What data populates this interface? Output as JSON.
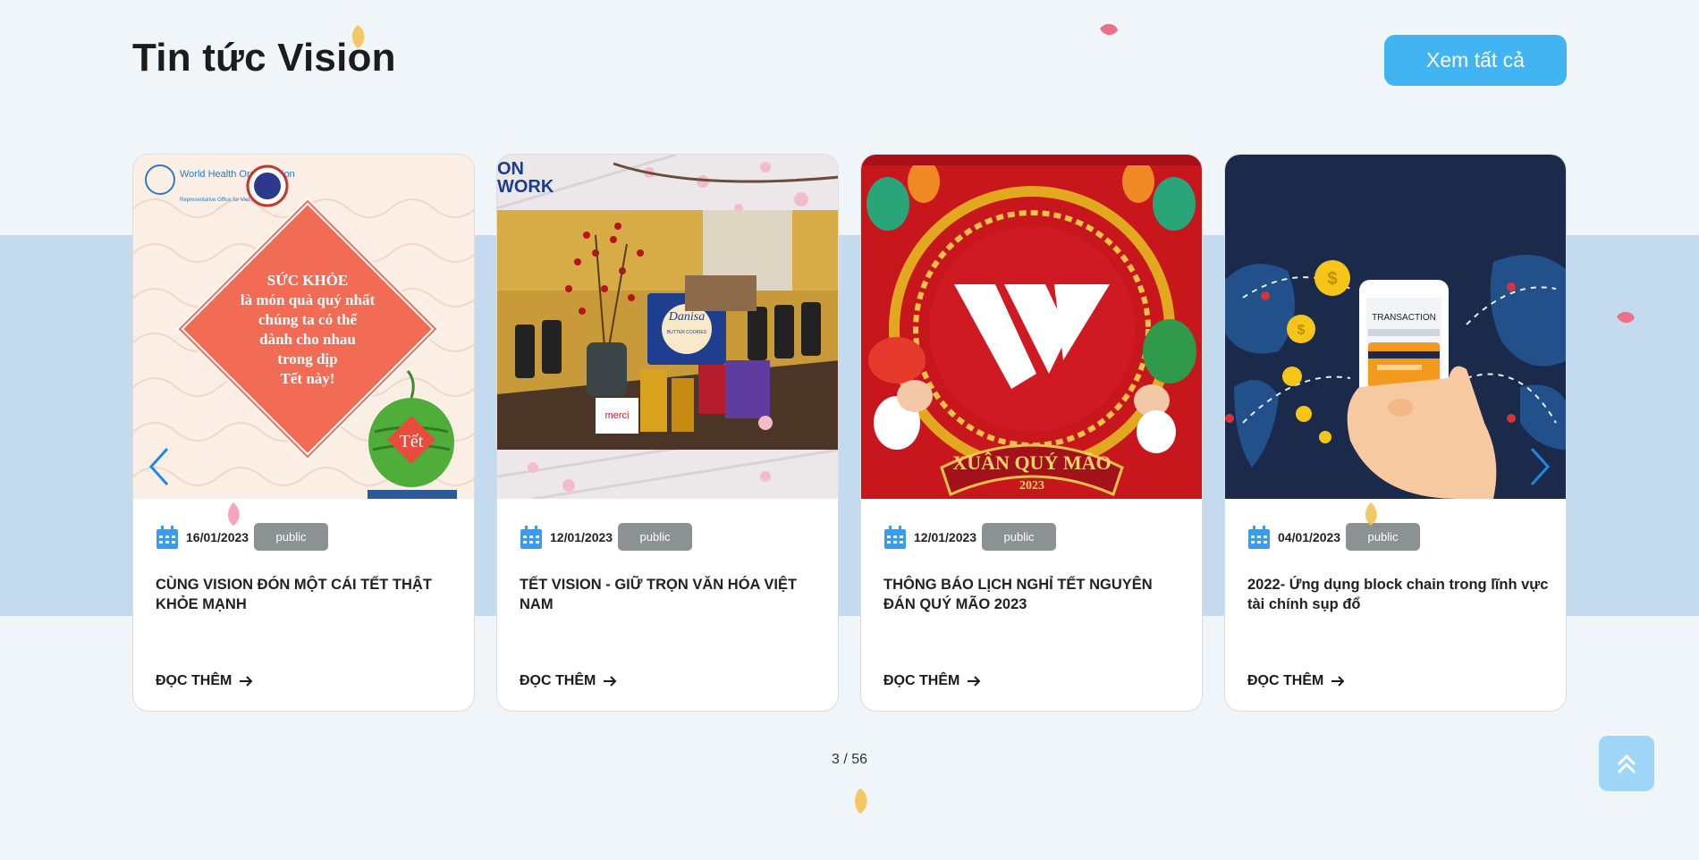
{
  "header": {
    "title": "Tin tức Vision",
    "view_all_label": "Xem tất cả"
  },
  "cards": [
    {
      "date": "16/01/2023",
      "badge": "public",
      "title": "CÙNG VISION ĐÓN MỘT CÁI TẾT THẬT KHỎE MẠNH",
      "read_more": "ĐỌC THÊM",
      "image": {
        "org_name": "World Health Organization",
        "org_sub": "Representative Office for Viet Nam",
        "lines": [
          "SỨC KHỎE",
          "là món quà quý nhất",
          "chúng ta có thể",
          "dành cho nhau",
          "trong dịp",
          "Tết này!"
        ],
        "tag": "Tết"
      }
    },
    {
      "date": "12/01/2023",
      "badge": "public",
      "title": "TẾT VISION - GIỮ TRỌN VĂN HÓA VIỆT NAM",
      "read_more": "ĐỌC THÊM",
      "image": {
        "corner_text_1": "ON",
        "corner_text_2": "WORK",
        "brand": "Danisa",
        "brand_sub": "BUTTER COOKIES",
        "box_text": "merci"
      }
    },
    {
      "date": "12/01/2023",
      "badge": "public",
      "title": "THÔNG BÁO LỊCH NGHỈ TẾT NGUYÊN ĐÁN QUÝ MÃO 2023",
      "read_more": "ĐỌC THÊM",
      "image": {
        "banner": "XUÂN QUÝ MÃO",
        "year": "2023"
      }
    },
    {
      "date": "04/01/2023",
      "badge": "public",
      "title": "2022- Ứng dụng block chain trong lĩnh vực tài chính sụp đổ",
      "read_more": "ĐỌC THÊM",
      "image": {
        "screen_text": "TRANSACTION"
      }
    }
  ],
  "pagination": {
    "text": "3 / 56"
  },
  "colors": {
    "accent": "#42b4f2",
    "band": "#c4daee",
    "badge": "#8c9294",
    "nav": "#1e88e5"
  }
}
